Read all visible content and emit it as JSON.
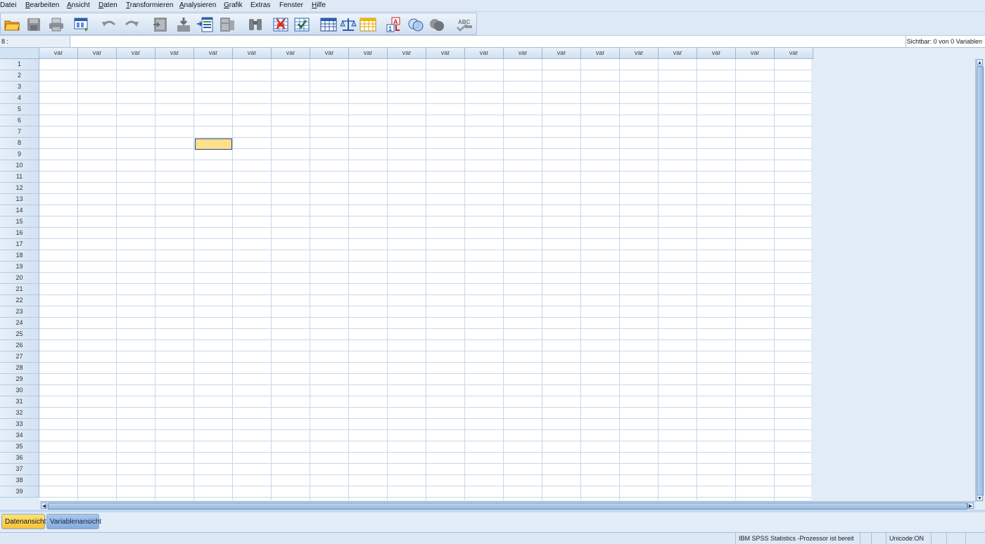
{
  "menu": [
    {
      "label": "Datei",
      "mnemonic": ""
    },
    {
      "label": "Bearbeiten",
      "mnemonic": "B"
    },
    {
      "label": "Ansicht",
      "mnemonic": "A"
    },
    {
      "label": "Daten",
      "mnemonic": "D"
    },
    {
      "label": "Transformieren",
      "mnemonic": "T"
    },
    {
      "label": "Analysieren",
      "mnemonic": "A"
    },
    {
      "label": "Grafik",
      "mnemonic": "G"
    },
    {
      "label": "Extras",
      "mnemonic": ""
    },
    {
      "label": "Fenster",
      "mnemonic": ""
    },
    {
      "label": "Hilfe",
      "mnemonic": "H"
    }
  ],
  "toolbar_icons": [
    "open-folder-icon",
    "save-icon",
    "print-icon",
    "recall-dialog-icon",
    "undo-icon",
    "redo-icon",
    "goto-case-icon",
    "goto-variable-icon",
    "variables-icon",
    "run-descriptives-icon",
    "find-icon",
    "insert-cases-icon",
    "insert-variable-icon",
    "split-file-icon",
    "weight-cases-icon",
    "select-cases-icon",
    "value-labels-icon",
    "use-variable-sets-icon",
    "show-all-variables-icon",
    "spell-check-icon"
  ],
  "cell_editor": {
    "reference": "8 :",
    "value": "",
    "visible_info": "Sichtbar: 0 von 0 Variablen"
  },
  "grid": {
    "column_label": "var",
    "column_count": 20,
    "row_count": 39,
    "active_row": 8,
    "active_column": 5
  },
  "tabs": {
    "data_view": "Datenansicht",
    "variable_view": "Variablenansicht"
  },
  "status": {
    "processor": "IBM SPSS Statistics -Prozessor ist bereit",
    "unicode": "Unicode:ON"
  },
  "colors": {
    "active_cell": "#ffe08a",
    "active_tab": "#f7c238",
    "inactive_tab": "#85acdb"
  }
}
